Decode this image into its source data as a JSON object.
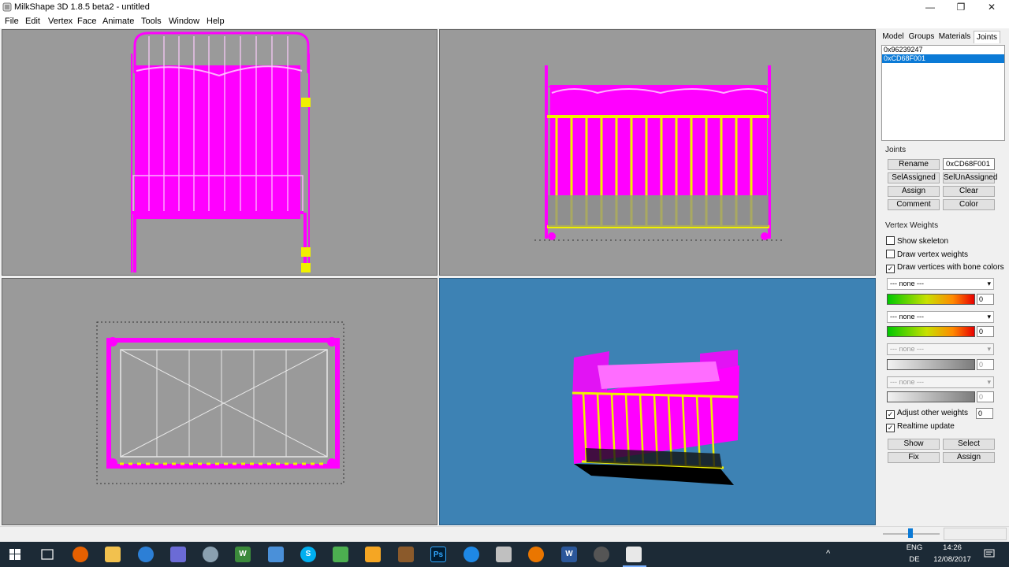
{
  "window": {
    "title": "MilkShape 3D 1.8.5 beta2 - untitled",
    "minimize_glyph": "—",
    "maximize_glyph": "❐",
    "close_glyph": "✕"
  },
  "menu": [
    "File",
    "Edit",
    "Vertex",
    "Face",
    "Animate",
    "Tools",
    "Window",
    "Help"
  ],
  "tabs": [
    "Model",
    "Groups",
    "Materials",
    "Joints"
  ],
  "active_tab": "Joints",
  "joints": {
    "list": [
      "0x96239247",
      "0xCD68F001"
    ],
    "selected": "0xCD68F001",
    "section_label": "Joints",
    "rename_label": "Rename",
    "name_value": "0xCD68F001",
    "sel_assigned_label": "SelAssigned",
    "sel_unassigned_label": "SelUnAssigned",
    "assign_label": "Assign",
    "clear_label": "Clear",
    "comment_label": "Comment",
    "color_label": "Color"
  },
  "vertex_weights": {
    "section_label": "Vertex Weights",
    "show_skeleton": {
      "label": "Show skeleton",
      "checked": false
    },
    "draw_vertex_weights": {
      "label": "Draw vertex weights",
      "checked": false
    },
    "draw_bone_colors": {
      "label": "Draw vertices with bone colors",
      "checked": true
    },
    "slots": [
      {
        "select": "--- none ---",
        "value": "0",
        "enabled": true
      },
      {
        "select": "--- none ---",
        "value": "0",
        "enabled": true
      },
      {
        "select": "--- none ---",
        "value": "0",
        "enabled": false
      },
      {
        "select": "--- none ---",
        "value": "0",
        "enabled": false
      }
    ],
    "adjust_other": {
      "label": "Adjust other weights",
      "checked": true,
      "value": "0"
    },
    "realtime_update": {
      "label": "Realtime update",
      "checked": true
    },
    "show_label": "Show",
    "select_label": "Select",
    "fix_label": "Fix",
    "assign_label": "Assign",
    "check_mark": "✓"
  },
  "colors": {
    "viewport_gray": "#9a9a9a",
    "viewport_blue": "#3d82b4",
    "mesh_magenta": "#ff00ff",
    "bone_yellow": "#f0f000",
    "selection_blue": "#0b7ad6"
  },
  "taskbar": {
    "icons": [
      "windows-start",
      "task-view",
      "firefox",
      "file-explorer",
      "thunderbird",
      "app",
      "app",
      "word-w",
      "app",
      "skype",
      "app",
      "media",
      "app",
      "photoshop",
      "app",
      "app",
      "blender",
      "word",
      "app",
      "milkshape"
    ],
    "word_glyph": "W",
    "skype_glyph": "S",
    "photoshop_glyph": "Ps",
    "tray_arrow_glyph": "^",
    "lang_line1": "ENG",
    "lang_line2": "DE",
    "time": "14:26",
    "date": "12/08/2017"
  }
}
